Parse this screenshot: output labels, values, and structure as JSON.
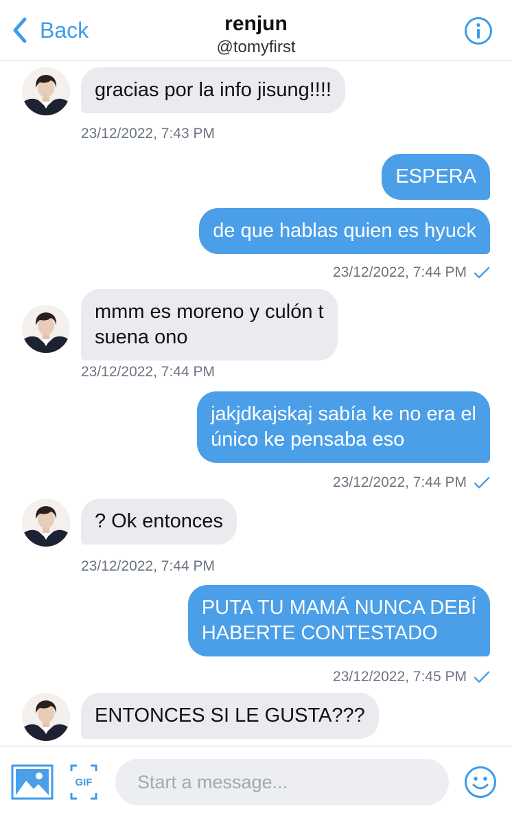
{
  "header": {
    "back_label": "Back",
    "title": "renjun",
    "handle": "@tomyfirst"
  },
  "messages": [
    {
      "direction": "in",
      "lines": [
        "gracias por la info jisung!!!!"
      ],
      "timestamp": "23/12/2022, 7:43 PM"
    },
    {
      "direction": "out",
      "lines": [
        "ESPERA"
      ]
    },
    {
      "direction": "out",
      "lines": [
        "de que hablas quien es hyuck"
      ],
      "timestamp": "23/12/2022, 7:44 PM"
    },
    {
      "direction": "in",
      "lines": [
        "mmm es moreno y culón t",
        "suena ono"
      ],
      "timestamp": "23/12/2022, 7:44 PM"
    },
    {
      "direction": "out",
      "lines": [
        "jakjdkajskaj sabía ke no era el",
        "único ke pensaba eso"
      ],
      "timestamp": "23/12/2022, 7:44 PM"
    },
    {
      "direction": "in",
      "lines": [
        "? Ok entonces"
      ],
      "timestamp": "23/12/2022, 7:44 PM"
    },
    {
      "direction": "out",
      "lines": [
        "PUTA TU MAMÁ NUNCA DEBÍ",
        "HABERTE CONTESTADO"
      ],
      "timestamp": "23/12/2022, 7:45 PM"
    },
    {
      "direction": "in",
      "lines": [
        "ENTONCES SI LE GUSTA???"
      ]
    }
  ],
  "composer": {
    "placeholder": "Start a message...",
    "gif_label": "GIF"
  },
  "colors": {
    "accent": "#3d9be9",
    "outgoing_bubble": "#4b9fe8",
    "incoming_bubble": "#e9ebee",
    "timestamp": "#6b7480"
  },
  "icons": {
    "back": "chevron-left-icon",
    "info": "info-icon",
    "media": "image-icon",
    "gif": "gif-icon",
    "emoji": "smiley-icon",
    "read": "checkmark-icon"
  }
}
